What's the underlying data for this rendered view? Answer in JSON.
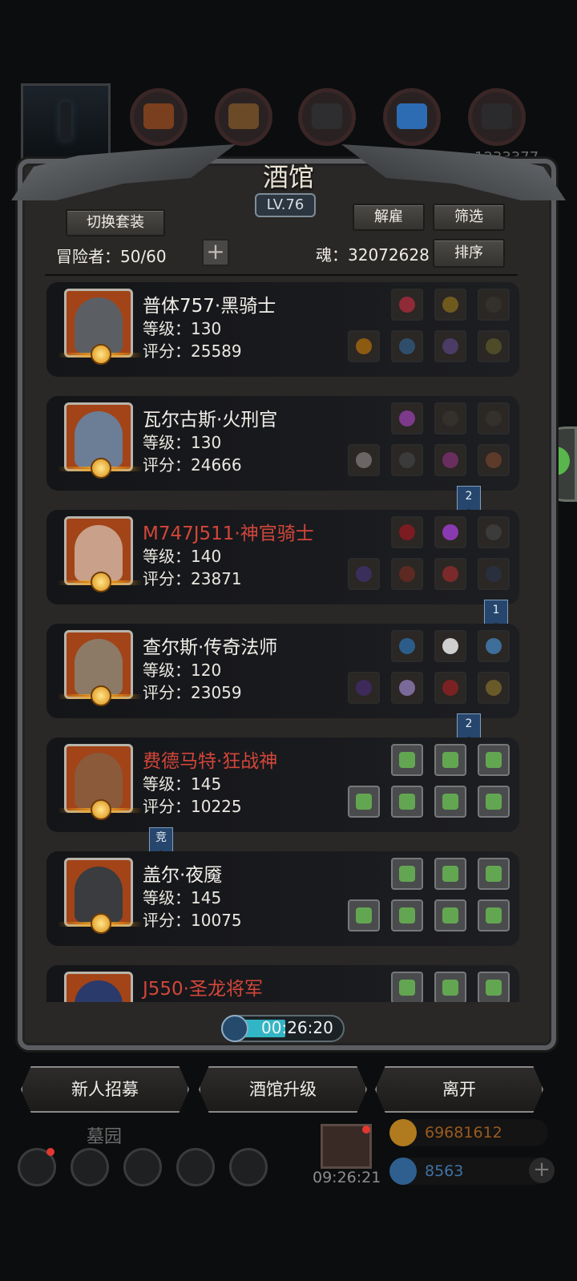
{
  "top_bar": {
    "portrait_icon": "lighthouse-portrait-icon",
    "resources": [
      "leather-icon",
      "wood-icon",
      "iron-icon",
      "crystal-icon",
      "stone-icon"
    ],
    "partial_number": "1233377"
  },
  "tavern": {
    "title": "酒馆",
    "level": "LV.76",
    "switch_outfit_label": "切换套装",
    "dismiss_label": "解雇",
    "filter_label": "筛选",
    "sort_label": "排序",
    "adventurers_text": "冒险者：50/60",
    "soul_text": "魂：32072628"
  },
  "adventurers": [
    {
      "name": "普体757·黑骑士",
      "name_color": "white",
      "level": "等级：130",
      "score": "评分：25589",
      "portrait_color": "#5b5f64",
      "top_equip": [
        "#8f2a37",
        "#6f5a1e",
        "#34302c"
      ],
      "bottom_equip": [
        "#8d5a12",
        "#2f4e6c",
        "#4a3c64",
        "#4e4c28"
      ],
      "badge": ""
    },
    {
      "name": "瓦尔古斯·火刑官",
      "name_color": "white",
      "level": "等级：130",
      "score": "评分：24666",
      "portrait_color": "#6c7d96",
      "top_equip": [
        "#7d3a8a",
        "#34302c",
        "#34302c"
      ],
      "bottom_equip": [
        "#6b6565",
        "#3b3b3b",
        "#6a2e5e",
        "#5e3a2a"
      ],
      "badge": "2"
    },
    {
      "name": "M747J511·神官骑士",
      "name_color": "red",
      "level": "等级：140",
      "score": "评分：23871",
      "portrait_color": "#c9a08a",
      "top_equip": [
        "#7a1c22",
        "#8a3ab0",
        "#3b3b3b"
      ],
      "bottom_equip": [
        "#3a2f5a",
        "#5c2a22",
        "#7a2a2a",
        "#2a2f3e"
      ],
      "badge": "1"
    },
    {
      "name": "查尔斯·传奇法师",
      "name_color": "white",
      "level": "等级：120",
      "score": "评分：23059",
      "portrait_color": "#8c7a66",
      "top_equip": [
        "#2c5d8a",
        "#cfcfcf",
        "#3e6e9a"
      ],
      "bottom_equip": [
        "#3d2a5a",
        "#7a6a9a",
        "#7a2222",
        "#6a5a2a"
      ],
      "badge": "2"
    },
    {
      "name": "费德马特·狂战神",
      "name_color": "red",
      "level": "等级：145",
      "score": "评分：10225",
      "portrait_color": "#8a5a3a",
      "top_equip": [
        "empty",
        "empty",
        "empty"
      ],
      "bottom_equip": [
        "empty",
        "empty",
        "empty",
        "empty"
      ],
      "badge": "竞"
    },
    {
      "name": "盖尔·夜魇",
      "name_color": "white",
      "level": "等级：145",
      "score": "评分：10075",
      "portrait_color": "#3a3c40",
      "top_equip": [
        "empty",
        "empty",
        "empty"
      ],
      "bottom_equip": [
        "empty",
        "empty",
        "empty",
        "empty"
      ],
      "badge": ""
    },
    {
      "name": "J550·圣龙将军",
      "name_color": "red",
      "level": "",
      "score": "",
      "portrait_color": "#2a3a6a",
      "top_equip": [
        "empty",
        "empty",
        "empty"
      ],
      "bottom_equip": [],
      "badge": ""
    }
  ],
  "timer": "00:26:20",
  "actions": {
    "recruit_label": "新人招募",
    "upgrade_label": "酒馆升级",
    "leave_label": "离开"
  },
  "bottom": {
    "cemetery_label": "墓园",
    "gift_timer": "09:26:21",
    "gold": "69681612",
    "gems": "8563",
    "icons": [
      "settings-icon",
      "emblem-icon",
      "book-icon",
      "mail-icon",
      "map-icon"
    ]
  }
}
